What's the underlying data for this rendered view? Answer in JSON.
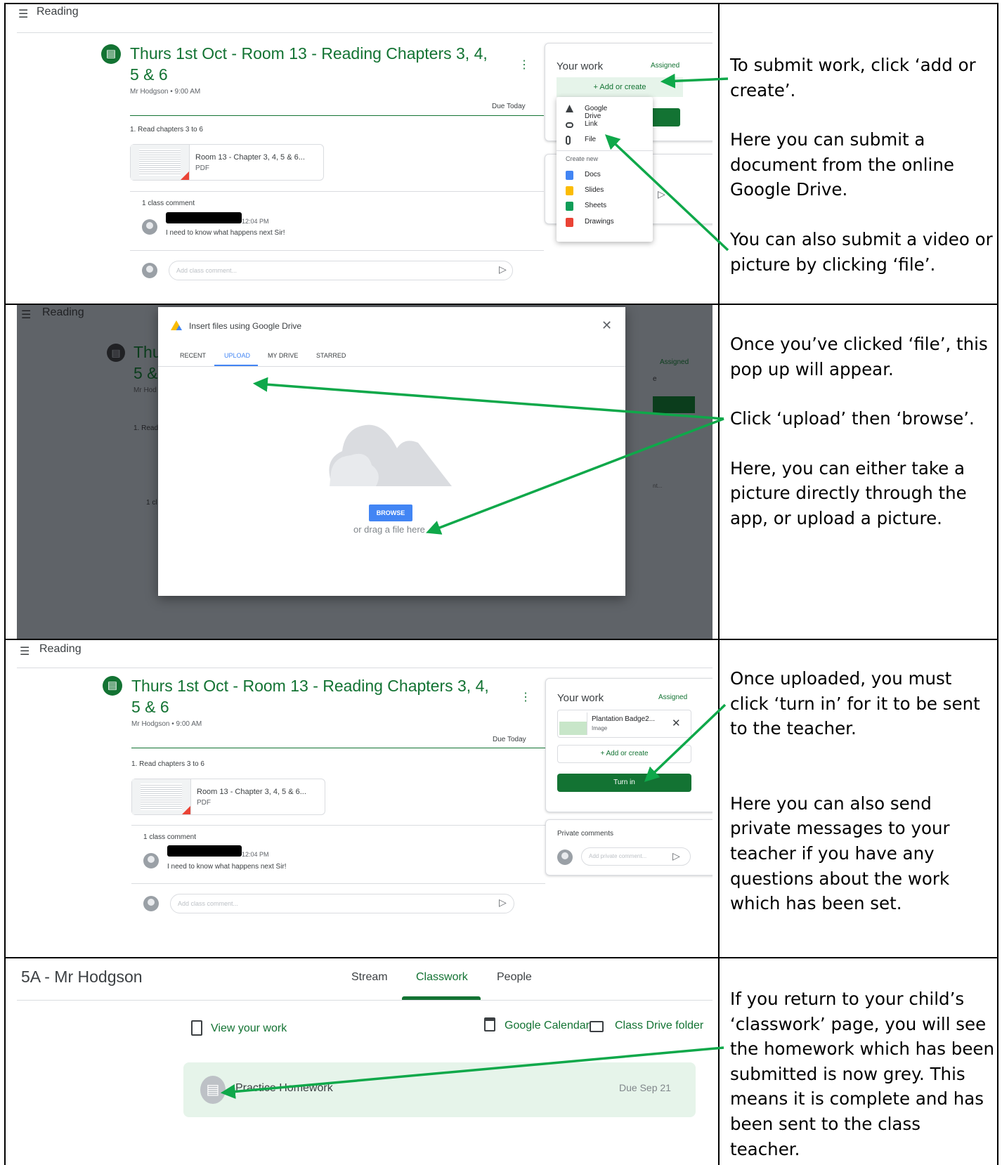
{
  "colors": {
    "accent_green": "#137333",
    "arrow_green": "#0fa84a",
    "blue_button": "#4285f4",
    "drawer_bg": "#e6f4ea"
  },
  "panel1": {
    "header": "Reading",
    "title_line1": "Thurs 1st Oct - Room 13 - Reading Chapters 3, 4,",
    "title_line2": "5 & 6",
    "teacher_time": "Mr Hodgson • 9:00 AM",
    "due": "Due Today",
    "instruction": "1. Read chapters 3 to 6",
    "attachment_name": "Room 13 - Chapter 3, 4, 5 & 6...",
    "attachment_type": "PDF",
    "comment_count": "1 class comment",
    "comment_time": "12:04 PM",
    "comment_text": "I need to know what happens next Sir!",
    "comment_placeholder": "Add class comment...",
    "your_work": "Your work",
    "status": "Assigned",
    "add_or_create": "+ Add or create",
    "menu_items": [
      "Google Drive",
      "Link",
      "File"
    ],
    "create_new": "Create new",
    "create_items": [
      "Docs",
      "Slides",
      "Sheets",
      "Drawings"
    ]
  },
  "panel2": {
    "header": "Reading",
    "bg_title_line1": "Thu",
    "bg_title_line2": "5 &",
    "bg_teacher": "Mr Hod",
    "bg_instruction": "1. Read",
    "bg_comment": "1 cl",
    "bg_status": "Assigned",
    "bg_input_tail": "e",
    "bg_private_tail": "nt...",
    "dialog_title": "Insert files using Google Drive",
    "tabs": [
      "RECENT",
      "UPLOAD",
      "MY DRIVE",
      "STARRED"
    ],
    "browse": "BROWSE",
    "drag_text": "or drag a file here"
  },
  "panel3": {
    "header": "Reading",
    "title_line1": "Thurs 1st Oct - Room 13 - Reading Chapters 3, 4,",
    "title_line2": "5 & 6",
    "teacher_time": "Mr Hodgson • 9:00 AM",
    "due": "Due Today",
    "instruction": "1. Read chapters 3 to 6",
    "attachment_name": "Room 13 - Chapter 3, 4, 5 & 6...",
    "attachment_type": "PDF",
    "comment_count": "1 class comment",
    "comment_time": "12:04 PM",
    "comment_text": "I need to know what happens next Sir!",
    "comment_placeholder": "Add class comment...",
    "your_work": "Your work",
    "status": "Assigned",
    "file_name": "Plantation Badge2...",
    "file_type": "Image",
    "add_or_create": "+ Add or create",
    "turn_in": "Turn in",
    "private_comments": "Private comments",
    "private_placeholder": "Add private comment..."
  },
  "panel4": {
    "class_title": "5A - Mr Hodgson",
    "tabs": [
      "Stream",
      "Classwork",
      "People"
    ],
    "view_work": "View your work",
    "calendar": "Google Calendar",
    "drive_folder": "Class Drive folder",
    "item_title": "Practice Homework",
    "item_due": "Due Sep 21"
  },
  "notes": {
    "n1_a": "To submit work, click ‘add or create’.",
    "n1_b": "Here you can submit a document from the online Google Drive.",
    "n1_c": "You can also submit a video or picture by clicking ‘file’.",
    "n2_a": "Once you’ve clicked ‘file’, this pop up will appear.",
    "n2_b": "Click ‘upload’ then ‘browse’.",
    "n2_c": "Here, you can either take a picture directly through the app, or upload a picture.",
    "n3_a": "Once uploaded, you must click ‘turn in’ for it to be sent to the teacher.",
    "n3_b": "Here you can also send private messages to your teacher if you have any questions about the work which has been set.",
    "n4_a": "If you return to your child’s ‘classwork’ page, you will see the homework which has been submitted is now grey. This means it is complete and has been sent to the class teacher."
  }
}
